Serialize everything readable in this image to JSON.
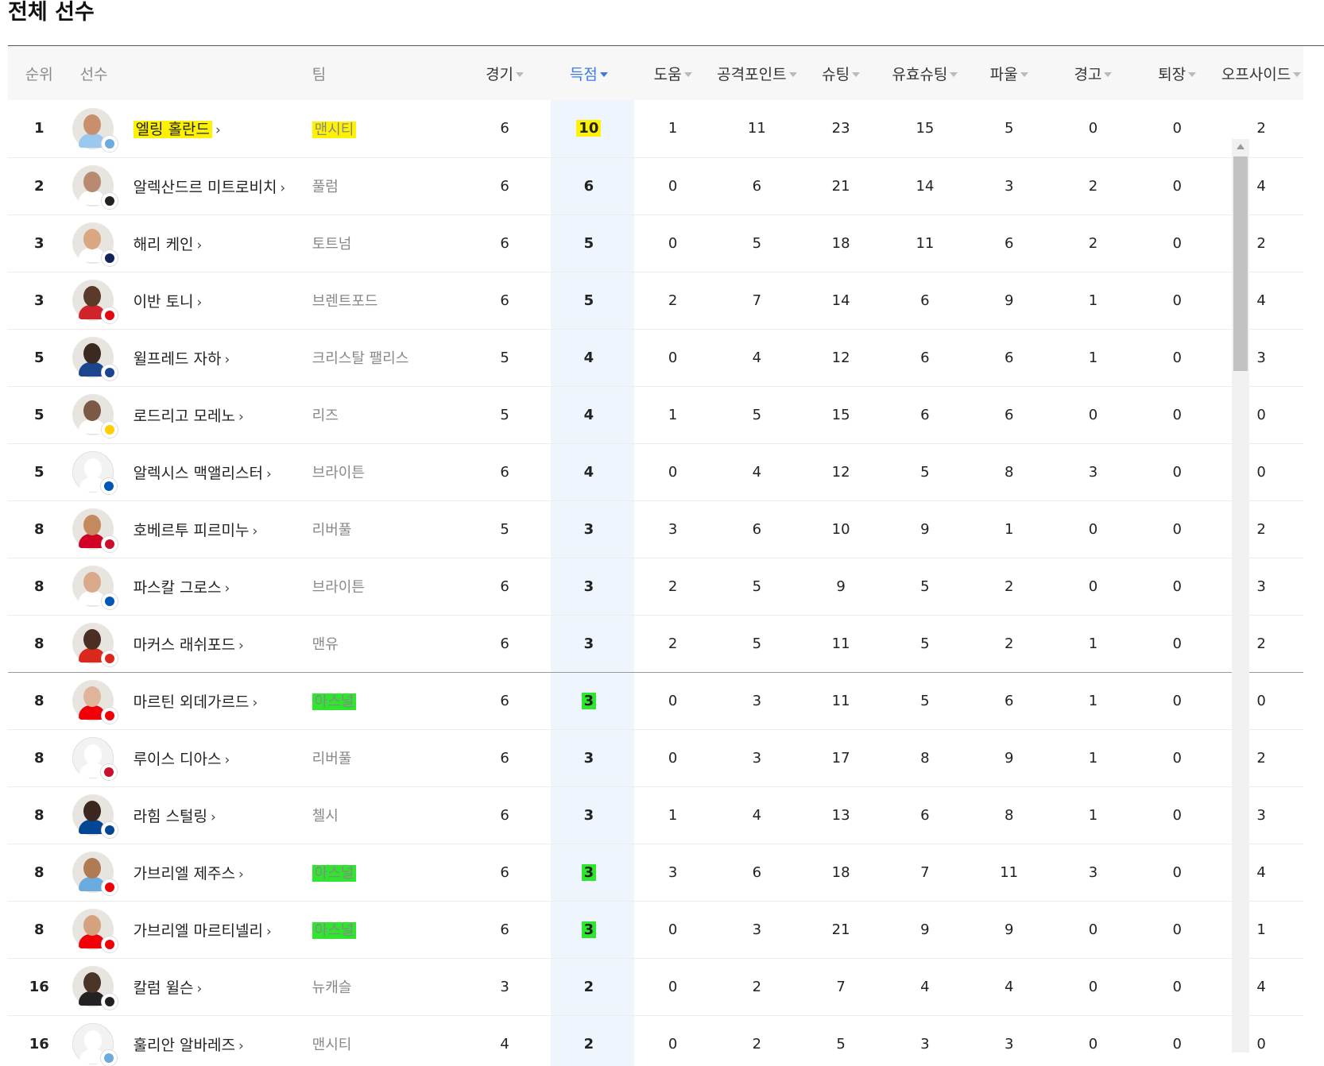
{
  "title": "전체 선수",
  "colors": {
    "accent": "#3b7be0",
    "highlight_yellow": "#fff200",
    "highlight_green": "#2ee62e"
  },
  "headers": {
    "rank": "순위",
    "player": "선수",
    "team": "팀",
    "stats": [
      "경기",
      "득점",
      "도움",
      "공격포인트",
      "슈팅",
      "유효슈팅",
      "파울",
      "경고",
      "퇴장",
      "오프사이드"
    ],
    "sorted_column": "득점"
  },
  "rows": [
    {
      "rank": "1",
      "name": "엘링 홀란드",
      "team": "맨시티",
      "stats": [
        "6",
        "10",
        "1",
        "11",
        "23",
        "15",
        "5",
        "0",
        "0",
        "2"
      ],
      "crest": "man-city-crest",
      "name_highlight": "yellow",
      "team_highlight": "yellow",
      "goals_highlight": "yellow"
    },
    {
      "rank": "2",
      "name": "알렉산드르 미트로비치",
      "team": "풀럼",
      "stats": [
        "6",
        "6",
        "0",
        "6",
        "21",
        "14",
        "3",
        "2",
        "0",
        "4"
      ],
      "crest": "fulham-crest"
    },
    {
      "rank": "3",
      "name": "해리 케인",
      "team": "토트넘",
      "stats": [
        "6",
        "5",
        "0",
        "5",
        "18",
        "11",
        "6",
        "2",
        "0",
        "2"
      ],
      "crest": "tottenham-crest"
    },
    {
      "rank": "3",
      "name": "이반 토니",
      "team": "브렌트포드",
      "stats": [
        "6",
        "5",
        "2",
        "7",
        "14",
        "6",
        "9",
        "1",
        "0",
        "4"
      ],
      "crest": "brentford-crest"
    },
    {
      "rank": "5",
      "name": "윌프레드 자하",
      "team": "크리스탈 팰리스",
      "stats": [
        "5",
        "4",
        "0",
        "4",
        "12",
        "6",
        "6",
        "1",
        "0",
        "3"
      ],
      "crest": "crystal-palace-crest"
    },
    {
      "rank": "5",
      "name": "로드리고 모레노",
      "team": "리즈",
      "stats": [
        "5",
        "4",
        "1",
        "5",
        "15",
        "6",
        "6",
        "0",
        "0",
        "0"
      ],
      "crest": "leeds-crest"
    },
    {
      "rank": "5",
      "name": "알렉시스 맥앨리스터",
      "team": "브라이튼",
      "stats": [
        "6",
        "4",
        "0",
        "4",
        "12",
        "5",
        "8",
        "3",
        "0",
        "0"
      ],
      "crest": "brighton-crest",
      "blank_avatar": true
    },
    {
      "rank": "8",
      "name": "호베르투 피르미누",
      "team": "리버풀",
      "stats": [
        "5",
        "3",
        "3",
        "6",
        "10",
        "9",
        "1",
        "0",
        "0",
        "2"
      ],
      "crest": "liverpool-crest"
    },
    {
      "rank": "8",
      "name": "파스칼 그로스",
      "team": "브라이튼",
      "stats": [
        "6",
        "3",
        "2",
        "5",
        "9",
        "5",
        "2",
        "0",
        "0",
        "3"
      ],
      "crest": "brighton-crest"
    },
    {
      "rank": "8",
      "name": "마커스 래쉬포드",
      "team": "맨유",
      "stats": [
        "6",
        "3",
        "2",
        "5",
        "11",
        "5",
        "2",
        "1",
        "0",
        "2"
      ],
      "crest": "man-utd-crest",
      "divider": true
    },
    {
      "rank": "8",
      "name": "마르틴 외데가르드",
      "team": "아스널",
      "stats": [
        "6",
        "3",
        "0",
        "3",
        "11",
        "5",
        "6",
        "1",
        "0",
        "0"
      ],
      "crest": "arsenal-crest",
      "team_highlight": "green",
      "goals_highlight": "green"
    },
    {
      "rank": "8",
      "name": "루이스 디아스",
      "team": "리버풀",
      "stats": [
        "6",
        "3",
        "0",
        "3",
        "17",
        "8",
        "9",
        "1",
        "0",
        "2"
      ],
      "crest": "liverpool-crest",
      "blank_avatar": true
    },
    {
      "rank": "8",
      "name": "라힘 스털링",
      "team": "첼시",
      "stats": [
        "6",
        "3",
        "1",
        "4",
        "13",
        "6",
        "8",
        "1",
        "0",
        "3"
      ],
      "crest": "chelsea-crest"
    },
    {
      "rank": "8",
      "name": "가브리엘 제주스",
      "team": "아스널",
      "stats": [
        "6",
        "3",
        "3",
        "6",
        "18",
        "7",
        "11",
        "3",
        "0",
        "4"
      ],
      "crest": "arsenal-crest",
      "team_highlight": "green",
      "goals_highlight": "green"
    },
    {
      "rank": "8",
      "name": "가브리엘 마르티넬리",
      "team": "아스널",
      "stats": [
        "6",
        "3",
        "0",
        "3",
        "21",
        "9",
        "9",
        "0",
        "0",
        "1"
      ],
      "crest": "arsenal-crest",
      "team_highlight": "green",
      "goals_highlight": "green"
    },
    {
      "rank": "16",
      "name": "칼럼 윌슨",
      "team": "뉴캐슬",
      "stats": [
        "3",
        "2",
        "0",
        "2",
        "7",
        "4",
        "4",
        "0",
        "0",
        "4"
      ],
      "crest": "newcastle-crest"
    },
    {
      "rank": "16",
      "name": "훌리안 알바레즈",
      "team": "맨시티",
      "stats": [
        "4",
        "2",
        "0",
        "2",
        "5",
        "3",
        "3",
        "0",
        "0",
        "0"
      ],
      "crest": "man-city-crest",
      "blank_avatar": true
    }
  ]
}
